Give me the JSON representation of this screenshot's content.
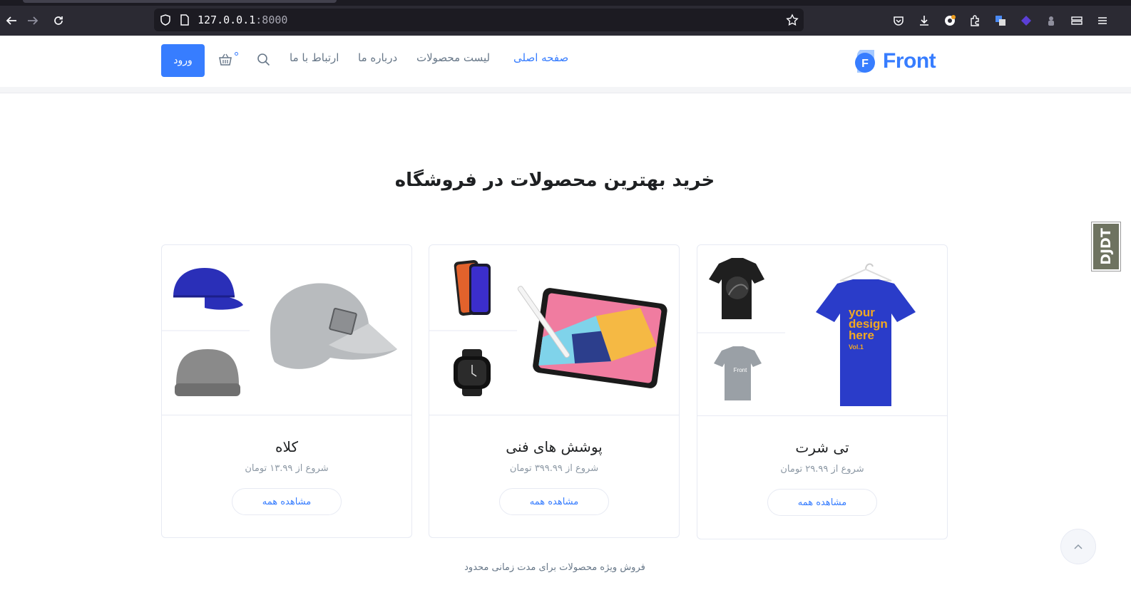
{
  "browser": {
    "url_host": "127.0.0.1",
    "url_port": ":8000"
  },
  "header": {
    "brand": "Front",
    "login_label": "ورود",
    "nav": {
      "home": "صفحه اصلی",
      "products": "لیست محصولات",
      "about": "درباره ما",
      "contact": "ارتباط با ما"
    }
  },
  "section": {
    "title": "خرید بهترین محصولات در فروشگاه"
  },
  "cards": [
    {
      "title": "تی شرت",
      "price": "شروع از ۲۹.۹۹ تومان",
      "button": "مشاهده همه",
      "shirt_text_line1": "your",
      "shirt_text_line2": "design",
      "shirt_text_line3": "here",
      "shirt_text_line4": "Vol.1",
      "small_shirt_text": "Front"
    },
    {
      "title": "پوشش های فنی",
      "price": "شروع از ۳۹۹.۹۹ تومان",
      "button": "مشاهده همه"
    },
    {
      "title": "کلاه",
      "price": "شروع از ۱۳.۹۹ تومان",
      "button": "مشاهده همه"
    }
  ],
  "footer_note": "فروش ویژه محصولات برای مدت زمانی محدود",
  "debug_toolbar": "DJDT",
  "colors": {
    "primary": "#377dff",
    "text_muted": "#677788",
    "title": "#1e2022"
  }
}
